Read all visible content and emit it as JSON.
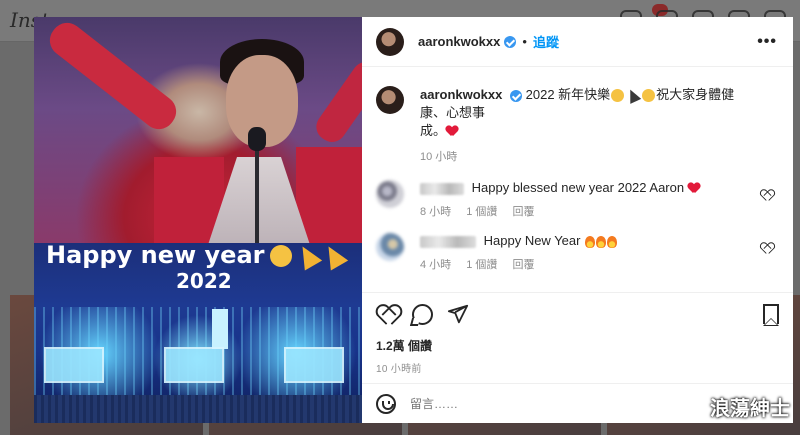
{
  "background": {
    "logo": "Inst"
  },
  "post": {
    "header": {
      "username": "aaronkwokxx",
      "follow_label": "追蹤",
      "more_label": "•••"
    },
    "image": {
      "line1": "Happy new year",
      "line2": "2022"
    },
    "caption": {
      "username": "aaronkwokxx",
      "text_part1": "2022 新年快樂",
      "text_part2": "祝大家身體健康、心想事",
      "text_part3": "成。",
      "time": "10 小時"
    },
    "comments": [
      {
        "text": "Happy blessed new year 2022 Aaron",
        "time": "8 小時",
        "likes": "1 個讚",
        "reply": "回覆"
      },
      {
        "text": "Happy New Year",
        "time": "4 小時",
        "likes": "1 個讚",
        "reply": "回覆"
      }
    ],
    "stats": {
      "views": "1.2萬 個讚",
      "posted": "10 小時前"
    },
    "add_comment": {
      "placeholder": "留言……"
    }
  },
  "watermark": "浪蕩紳士",
  "colors": {
    "accent": "#0095f6",
    "verified": "#3897f0",
    "heart": "#e21a3a"
  }
}
